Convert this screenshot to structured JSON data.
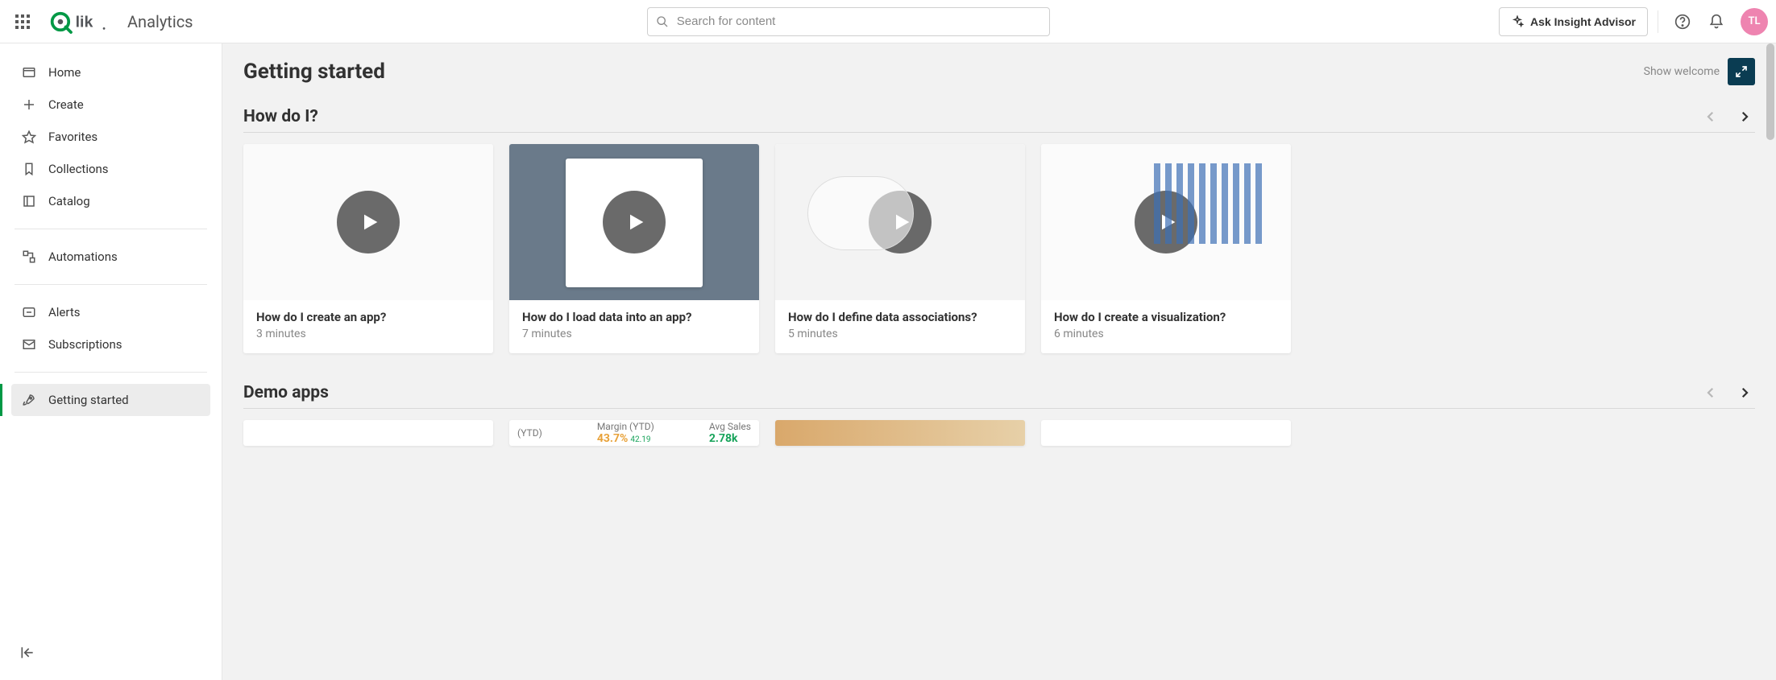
{
  "header": {
    "product": "Analytics",
    "search_placeholder": "Search for content",
    "insight_button": "Ask Insight Advisor",
    "avatar_initials": "TL"
  },
  "sidebar": {
    "items": [
      {
        "id": "home",
        "label": "Home"
      },
      {
        "id": "create",
        "label": "Create"
      },
      {
        "id": "favorites",
        "label": "Favorites"
      },
      {
        "id": "collections",
        "label": "Collections"
      },
      {
        "id": "catalog",
        "label": "Catalog"
      },
      {
        "id": "automations",
        "label": "Automations"
      },
      {
        "id": "alerts",
        "label": "Alerts"
      },
      {
        "id": "subscriptions",
        "label": "Subscriptions"
      },
      {
        "id": "getting-started",
        "label": "Getting started"
      }
    ]
  },
  "main": {
    "title": "Getting started",
    "show_welcome": "Show welcome",
    "sections": {
      "howdoi": {
        "title": "How do I?",
        "cards": [
          {
            "title": "How do I create an app?",
            "duration": "3 minutes"
          },
          {
            "title": "How do I load data into an app?",
            "duration": "7 minutes"
          },
          {
            "title": "How do I define data associations?",
            "duration": "5 minutes"
          },
          {
            "title": "How do I create a visualization?",
            "duration": "6 minutes"
          }
        ]
      },
      "demoapps": {
        "title": "Demo apps",
        "metrics": {
          "col1": "(YTD)",
          "margin_label": "Margin (YTD)",
          "margin_value": "43.7%",
          "margin_delta": "42.19",
          "avg_label": "Avg Sales",
          "avg_value": "2.78k"
        }
      }
    }
  }
}
